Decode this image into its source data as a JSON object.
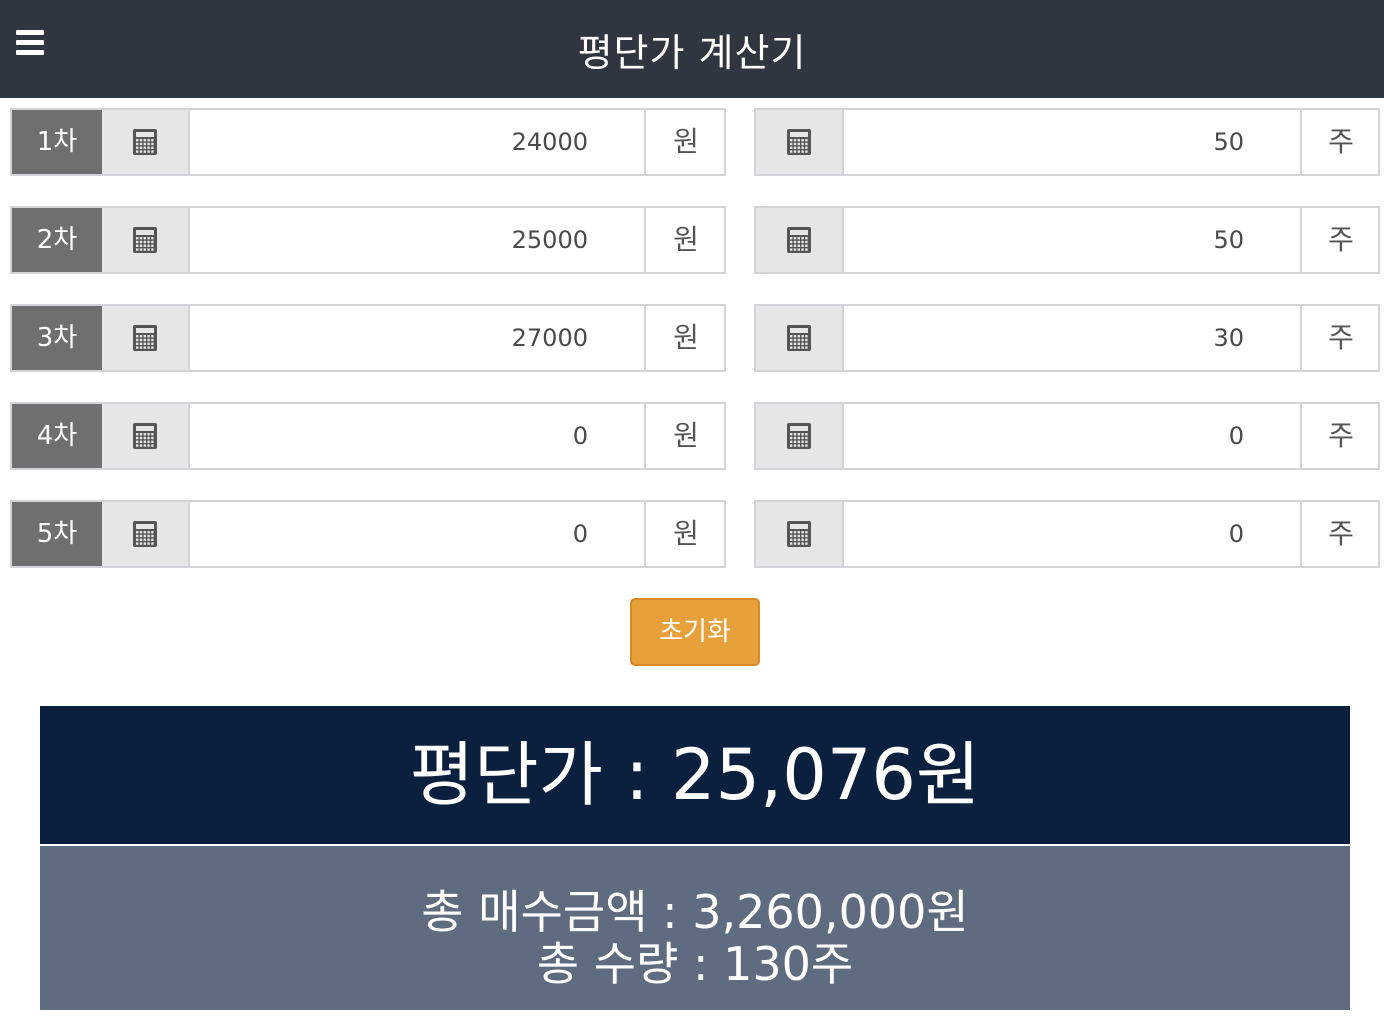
{
  "header": {
    "title": "평단가 계산기",
    "menu_icon": "hamburger-menu-icon"
  },
  "rows": [
    {
      "round": "1차",
      "price": "24000",
      "price_unit": "원",
      "qty": "50",
      "qty_unit": "주"
    },
    {
      "round": "2차",
      "price": "25000",
      "price_unit": "원",
      "qty": "50",
      "qty_unit": "주"
    },
    {
      "round": "3차",
      "price": "27000",
      "price_unit": "원",
      "qty": "30",
      "qty_unit": "주"
    },
    {
      "round": "4차",
      "price": "0",
      "price_unit": "원",
      "qty": "0",
      "qty_unit": "주"
    },
    {
      "round": "5차",
      "price": "0",
      "price_unit": "원",
      "qty": "0",
      "qty_unit": "주"
    }
  ],
  "reset_label": "초기화",
  "result": {
    "average": "평단가 : 25,076원",
    "total_amount": "총 매수금액 : 3,260,000원",
    "total_qty": "총 수량 : 130주"
  },
  "colors": {
    "header_bg": "#2f3640",
    "round_label_bg": "#6f6f6f",
    "reset_button": "#e8a03a",
    "average_bg": "#0b1f3e",
    "totals_bg": "#5f6c7f"
  }
}
